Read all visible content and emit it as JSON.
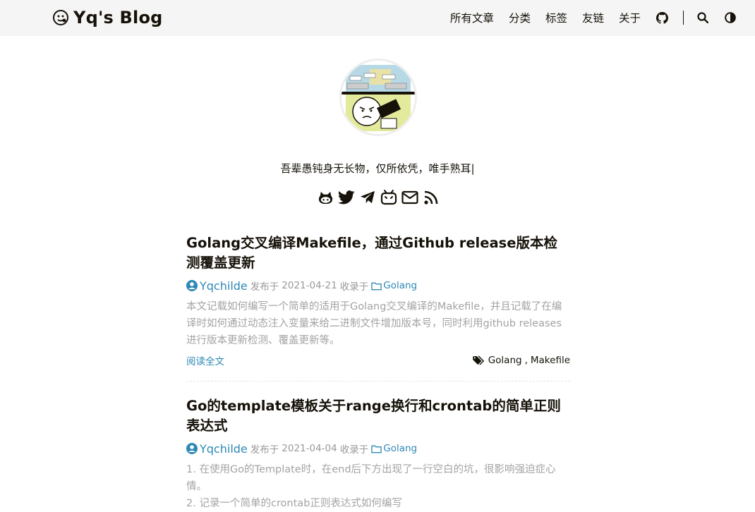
{
  "header": {
    "title": "Yq's Blog",
    "nav": [
      "所有文章",
      "分类",
      "标签",
      "友链",
      "关于"
    ]
  },
  "profile": {
    "subtitle": "吾辈愚钝身无长物，仅所依凭，唯手熟耳|",
    "social_icons": [
      "github-icon",
      "twitter-icon",
      "telegram-icon",
      "bilibili-icon",
      "email-icon",
      "rss-icon"
    ]
  },
  "posts": [
    {
      "title": "Golang交叉编译Makefile，通过Github release版本检测覆盖更新",
      "author": "Yqchilde",
      "published_prefix": "发布于",
      "date": "2021-04-21",
      "category_prefix": "收录于",
      "category": "Golang",
      "summary": "本文记载如何编写一个简单的适用于Golang交叉编译的Makefile，并且记载了在编译时如何通过动态注入变量来给二进制文件增加版本号，同时利用github releases进行版本更新检测、覆盖更新等。",
      "read_more": "阅读全文",
      "tags": [
        "Golang",
        "Makefile"
      ]
    },
    {
      "title": "Go的template模板关于range换行和crontab的简单正则表达式",
      "author": "Yqchilde",
      "published_prefix": "发布于",
      "date": "2021-04-04",
      "category_prefix": "收录于",
      "category": "Golang",
      "summary_lines": [
        "1. 在使用Go的Template时，在end后下方出现了一行空白的坑，很影响强迫症心情。",
        "2. 记录一个简单的crontab正则表达式如何编写"
      ]
    }
  ],
  "colors": {
    "accent": "#2e88b6",
    "text": "#161209",
    "muted": "#a3a3a3",
    "header_bg": "#f5f5f5"
  }
}
